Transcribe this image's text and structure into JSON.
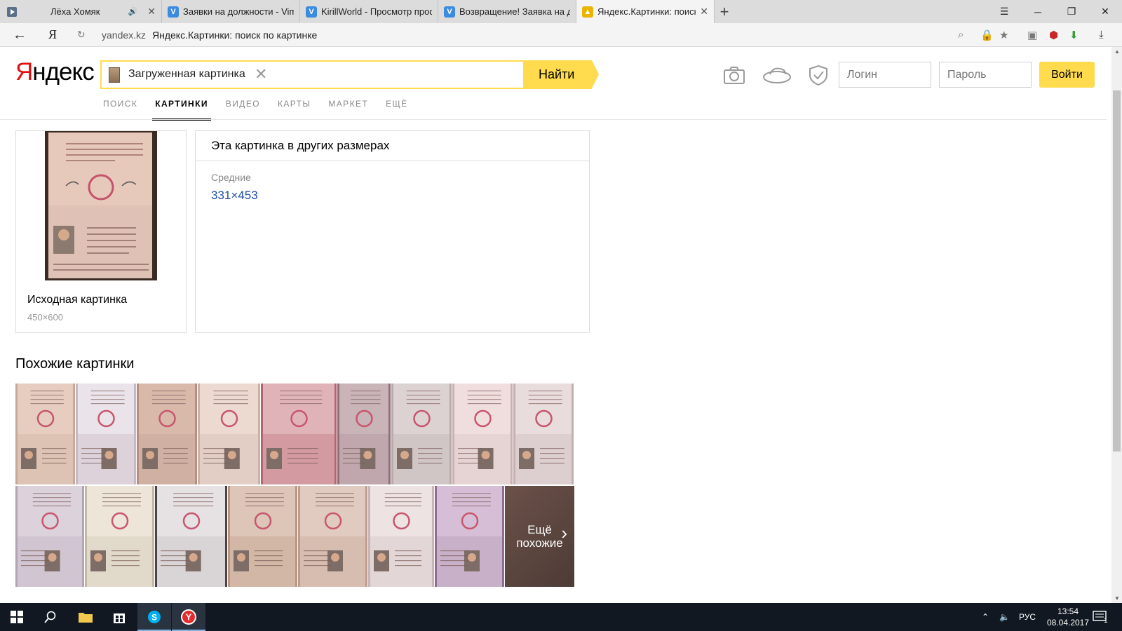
{
  "browser": {
    "tabs": [
      {
        "title": "Лёха Хомяк",
        "favicon": "none",
        "sound": "speaker-icon"
      },
      {
        "title": "Заявки на должности - Vim",
        "favicon": "V"
      },
      {
        "title": "KirillWorld - Просмотр проф",
        "favicon": "V"
      },
      {
        "title": "Возвращение! Заявка на до",
        "favicon": "V"
      },
      {
        "title": "Яндекс.Картинки: поиск",
        "favicon": "img",
        "active": true
      }
    ],
    "new_tab": "+",
    "address": {
      "yandex_button": "Я",
      "domain": "yandex.kz",
      "page_title": "Яндекс.Картинки: поиск по картинке"
    }
  },
  "header": {
    "logo": {
      "red": "Я",
      "rest": "ндекс"
    },
    "search": {
      "value": "Загруженная картинка",
      "clear": "✕"
    },
    "find_button": "Найти",
    "login_placeholder": "Логин",
    "password_placeholder": "Пароль",
    "login_button": "Войти"
  },
  "nav": [
    {
      "label": "ПОИСК"
    },
    {
      "label": "КАРТИНКИ",
      "active": true
    },
    {
      "label": "ВИДЕО"
    },
    {
      "label": "КАРТЫ"
    },
    {
      "label": "МАРКЕТ"
    },
    {
      "label": "ЕЩЁ"
    }
  ],
  "original": {
    "caption": "Исходная картинка",
    "size": "450×600"
  },
  "other_sizes": {
    "heading": "Эта картинка в других размерах",
    "group_label": "Средние",
    "link": "331×453"
  },
  "similar": {
    "heading": "Похожие картинки",
    "more_label_line1": "Ещё",
    "more_label_line2": "похожие"
  },
  "taskbar": {
    "language": "РУС",
    "time": "13:54",
    "date": "08.04.2017",
    "notifications": "1"
  },
  "colors": {
    "accent_yellow": "#ffdb4d",
    "logo_red": "#e01010",
    "link_blue": "#1f4ea6"
  }
}
